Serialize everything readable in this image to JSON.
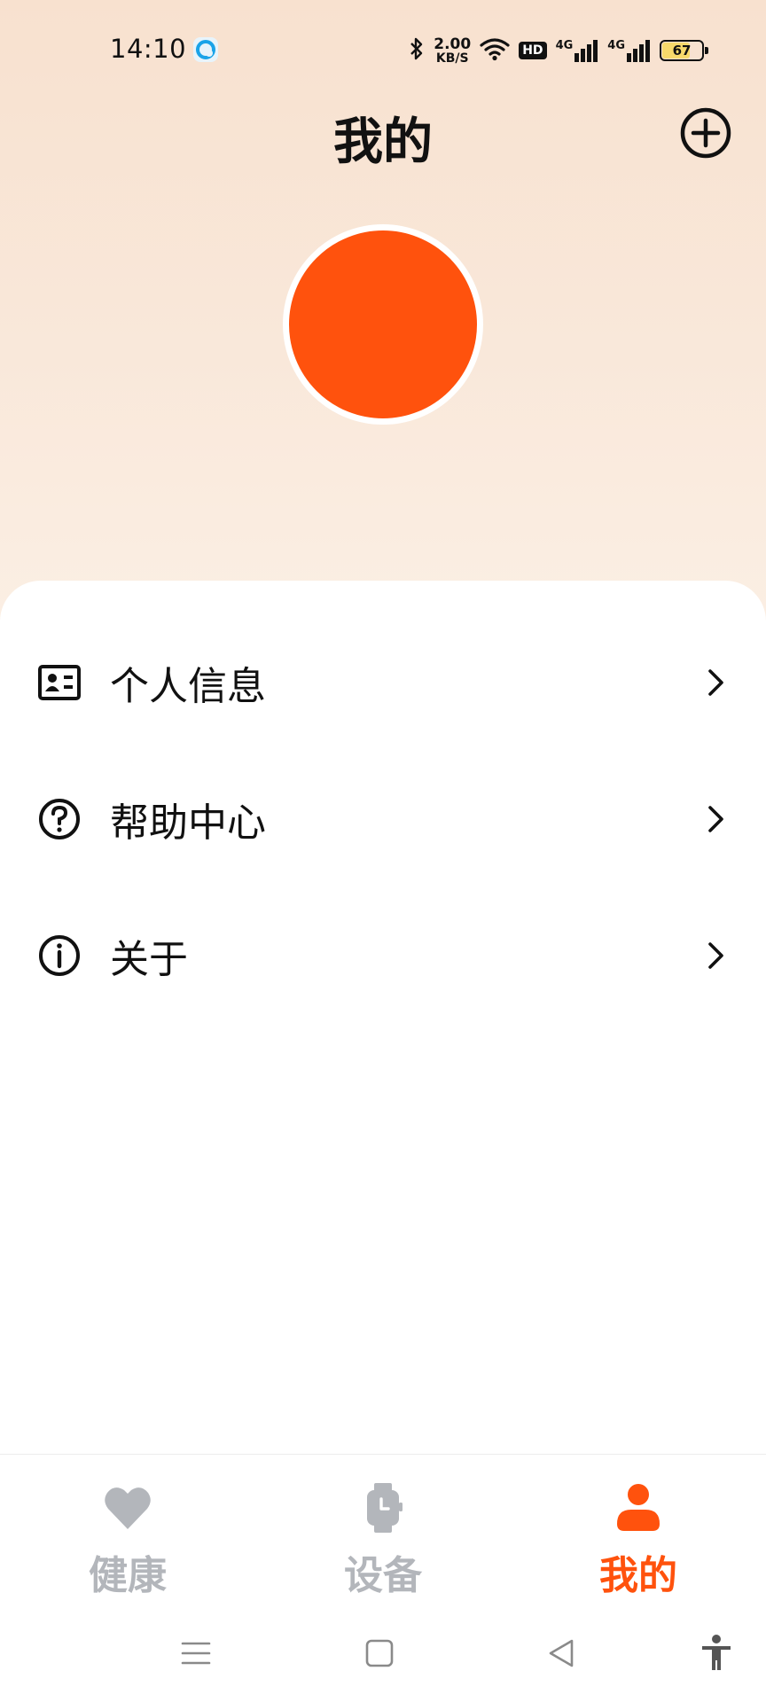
{
  "status_bar": {
    "time": "14:10",
    "net_speed_value": "2.00",
    "net_speed_unit": "KB/S",
    "hd_label": "HD",
    "signal_1_label": "4G",
    "signal_2_label": "4G",
    "battery_level": "67"
  },
  "header": {
    "title": "我的",
    "add_icon": "plus-circle-icon"
  },
  "avatar": {
    "color": "#ff520d"
  },
  "menu": {
    "items": [
      {
        "label": "个人信息",
        "icon": "id-card-icon"
      },
      {
        "label": "帮助中心",
        "icon": "question-circle-icon"
      },
      {
        "label": "关于",
        "icon": "info-circle-icon"
      }
    ]
  },
  "bottom_nav": {
    "tabs": [
      {
        "label": "健康",
        "icon": "heart-icon",
        "active": false
      },
      {
        "label": "设备",
        "icon": "watch-icon",
        "active": false
      },
      {
        "label": "我的",
        "icon": "person-icon",
        "active": true
      }
    ]
  },
  "colors": {
    "accent": "#ff520d",
    "inactive": "#b3b6bb",
    "header_bg": "#f8e1cf"
  }
}
